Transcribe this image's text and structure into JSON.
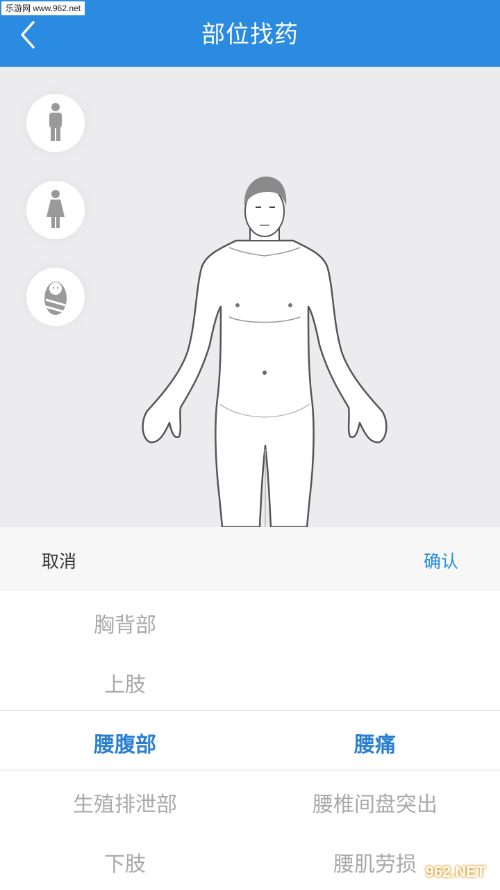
{
  "header": {
    "title": "部位找药",
    "watermark": "乐游网 www.962.net",
    "accent_color": "#2a8be0"
  },
  "sidebar": {
    "buttons": [
      {
        "name": "male",
        "icon": "male-icon"
      },
      {
        "name": "female",
        "icon": "female-icon"
      },
      {
        "name": "baby",
        "icon": "baby-icon"
      }
    ]
  },
  "picker": {
    "cancel_label": "取消",
    "confirm_label": "确认",
    "left_options": [
      "胸背部",
      "上肢",
      "腰腹部",
      "生殖排泄部",
      "下肢"
    ],
    "left_selected": "腰腹部",
    "right_options": [
      "腰痛",
      "腰椎间盘突出",
      "腰肌劳损"
    ],
    "right_selected": "腰痛",
    "selected_color": "#2a7fd0"
  },
  "footer": {
    "watermark": "962.NET"
  }
}
